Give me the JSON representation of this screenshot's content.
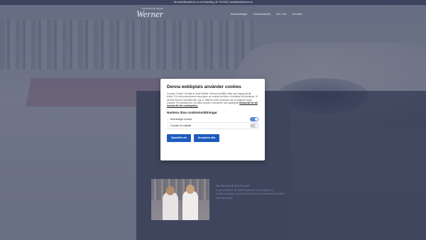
{
  "topbar": {
    "prefix": "Tala tandhälsoaktör av, ut av behandling",
    "phone": "46 709 8000",
    "sep": " | ",
    "email": "tandlakare@werner.se"
  },
  "logo": {
    "small": "Tandvårdsgruppen",
    "big": "Werner"
  },
  "nav": [
    "Behandlingar",
    "Tandvårdsråd",
    "Om Oss",
    "Kontakt"
  ],
  "modal": {
    "title": "Denna webbplats använder cookies",
    "body": "Cookies (\"kakor\") består av små textfiler. Dessa innehåller data som lagras på din enhet. För att kunna placera vissa typer av cookies behöver vi inhämta ditt samtycke. Vi på Eva Werner Tandvård AB, org.nr: 556000-0000 använder oss av följande slags cookies. För att läsa mer om vilka cookies vi använder och lagringstid ",
    "link": "klicka här för att komma till vår cookiepolicy.",
    "manage_title": "Hantera dina cookieinställningar",
    "settings": [
      {
        "label": "Nödvändiga cookies",
        "enabled": true
      },
      {
        "label": "Cookies för statistik",
        "enabled": false
      }
    ],
    "btn_save": "Spara/Ha val",
    "btn_accept": "Acceptera alla"
  },
  "team": {
    "title": "Åsa Werner & Eva Forsell",
    "text": "Vi på tandvården blir aktivitetspartners och smärtfria ev. tandbehandlingar och sedan fyra år finns vår verksamhet att gå för ökat välmående."
  },
  "colors": {
    "button": "#1e5bbf",
    "toggle_on": "#4d89d6",
    "toggle_off": "#c7cad1"
  }
}
